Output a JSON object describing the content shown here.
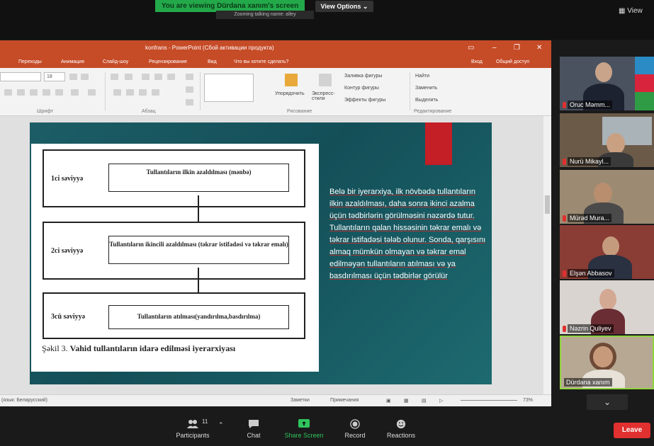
{
  "zoom": {
    "banner": "You are viewing Dürdana xanım's screen",
    "talking": "Zooming talking name: alley",
    "view_options": "View Options ⌄",
    "view_button": "▦ View",
    "leave": "Leave",
    "participants_count": "11",
    "toolbar": [
      {
        "label": "Participants",
        "icon": "participants-icon"
      },
      {
        "label": "Chat",
        "icon": "chat-icon"
      },
      {
        "label": "Share Screen",
        "icon": "share-screen-icon"
      },
      {
        "label": "Record",
        "icon": "record-icon"
      },
      {
        "label": "Reactions",
        "icon": "reactions-icon"
      }
    ],
    "participants": [
      {
        "name": "Oruc Məmm..."
      },
      {
        "name": "Nurü Mikayl..."
      },
      {
        "name": "Mürəd Mura..."
      },
      {
        "name": "Elşən Abbasov"
      },
      {
        "name": "Nəzrin Quliyev"
      },
      {
        "name": "Dürdana xanım"
      }
    ]
  },
  "ppt": {
    "title": "konfrans - PowerPoint (Сбой активации продукта)",
    "menu": [
      "Переходы",
      "Анимация",
      "Слайд-шоу",
      "Рецензирование",
      "Вид",
      "Что вы хотите сделать?"
    ],
    "menu_right": [
      "Вход",
      "Общий доступ"
    ],
    "groups": [
      "Шрифт",
      "Абзац",
      "Рисование",
      "Редактирование"
    ],
    "ribbon_labels": {
      "arrange": "Упорядочить",
      "quick_styles": "Экспресс-стили",
      "fill": "Заливка фигуры",
      "outline": "Контур фигуры",
      "effects": "Эффекты фигуры",
      "find": "Найти",
      "replace": "Заменить",
      "select": "Выделить"
    },
    "font_size": "18",
    "statusbar": {
      "left": "(язык: Беларусский)",
      "notes": "Заметки",
      "comments": "Примечания",
      "zoom": "73%"
    },
    "slide": {
      "levels": [
        {
          "label": "1ci səviyyə",
          "text": "Tullantıların ilkin azaldılması (mənbə)"
        },
        {
          "label": "2ci səviyyə",
          "text": "Tullantıların ikincili azaldılması (təkrar istifadəsi və təkrar emalı)"
        },
        {
          "label": "3cü səviyyə",
          "text": "Tullantıların atılması(yandırılma,basdırılma)"
        }
      ],
      "caption_prefix": "Şəkil 3.",
      "caption_title": "Vahid tullantıların idarə edilməsi iyerarxiyası",
      "text": "Belə bir iyerarxiya, ilk növbədə tullantıların ilkin azaldılması, daha sonra ikinci azalma üçün tədbirlərin görülməsini nəzərdə tutur. Tullantıların qalan hissəsinin təkrar emalı və təkrar istifadəsi tələb olunur. Sonda, qarşısını almaq mümkün olmayan və təkrar emal edilməyən tullantıların atılması və ya basdırılması üçün tədbirlər görülür"
    }
  }
}
